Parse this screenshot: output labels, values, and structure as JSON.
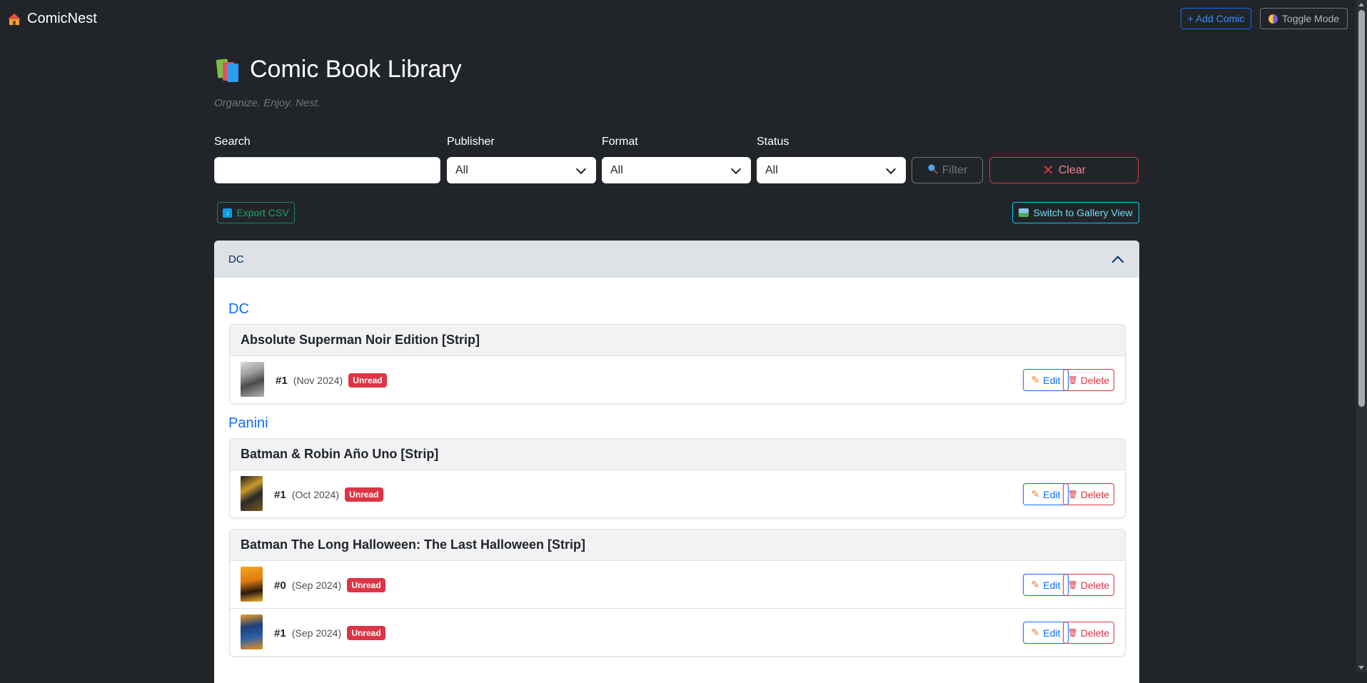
{
  "navbar": {
    "brand": "ComicNest",
    "add_button": "+ Add Comic",
    "toggle_button": "Toggle Mode"
  },
  "header": {
    "title": "Comic Book Library",
    "subtitle": "Organize. Enjoy. Nest."
  },
  "filters": {
    "search_label": "Search",
    "search_value": "",
    "publisher_label": "Publisher",
    "publisher_value": "All",
    "format_label": "Format",
    "format_value": "All",
    "status_label": "Status",
    "status_value": "All",
    "filter_button": "Filter",
    "clear_button": "Clear"
  },
  "actions": {
    "export_button": "Export CSV",
    "gallery_button": "Switch to Gallery View"
  },
  "accordion": {
    "header": "DC",
    "groups": [
      {
        "publisher": "DC",
        "series": [
          {
            "title": "Absolute Superman Noir Edition [Strip]",
            "issues": [
              {
                "number": "#1",
                "date": "(Nov 2024)",
                "status": "Unread"
              }
            ]
          }
        ]
      },
      {
        "publisher": "Panini",
        "series": [
          {
            "title": "Batman & Robin Año Uno [Strip]",
            "issues": [
              {
                "number": "#1",
                "date": "(Oct 2024)",
                "status": "Unread"
              }
            ]
          },
          {
            "title": "Batman The Long Halloween: The Last Halloween [Strip]",
            "issues": [
              {
                "number": "#0",
                "date": "(Sep 2024)",
                "status": "Unread"
              },
              {
                "number": "#1",
                "date": "(Sep 2024)",
                "status": "Unread"
              }
            ]
          }
        ]
      }
    ]
  },
  "row_actions": {
    "edit": "Edit",
    "delete": "Delete"
  },
  "colors": {
    "background": "#212529",
    "primary": "#0d6efd",
    "danger": "#dc3545",
    "success": "#198754",
    "info": "#0dcaf0"
  }
}
